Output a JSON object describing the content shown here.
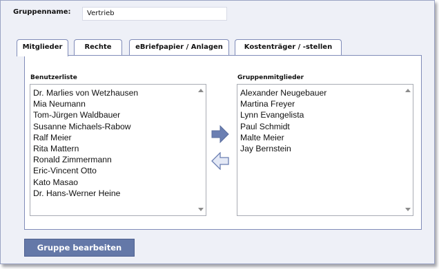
{
  "group": {
    "label": "Gruppenname:",
    "value": "Vertrieb"
  },
  "tabs": [
    {
      "label": "Mitglieder",
      "active": true
    },
    {
      "label": "Rechte",
      "active": false
    },
    {
      "label": "eBriefpapier / Anlagen",
      "active": false
    },
    {
      "label": "Kostenträger / -stellen",
      "active": false
    }
  ],
  "user_list": {
    "label": "Benutzerliste",
    "items": [
      "Dr. Marlies von Wetzhausen",
      "Mia Neumann",
      "Tom-Jürgen Waldbauer",
      "Susanne Michaels-Rabow",
      "Ralf Meier",
      "Rita Mattern",
      "Ronald Zimmermann",
      "Eric-Vincent Otto",
      "Kato Masao",
      "Dr. Hans-Werner Heine"
    ]
  },
  "member_list": {
    "label": "Gruppenmitglieder",
    "items": [
      "Alexander Neugebauer",
      "Martina Freyer",
      "Lynn Evangelista",
      "Paul Schmidt",
      "Malte Meier",
      "Jay Bernstein"
    ]
  },
  "actions": {
    "add_icon": "arrow-right-icon",
    "remove_icon": "arrow-left-icon",
    "edit_label": "Gruppe bearbeiten"
  },
  "colors": {
    "accent": "#6478a8",
    "tab_border": "#7f8bb8",
    "background": "#eef0f7",
    "arrow_fill": "#6b7fb2",
    "arrow_outline_fill": "#e4e9f6"
  }
}
